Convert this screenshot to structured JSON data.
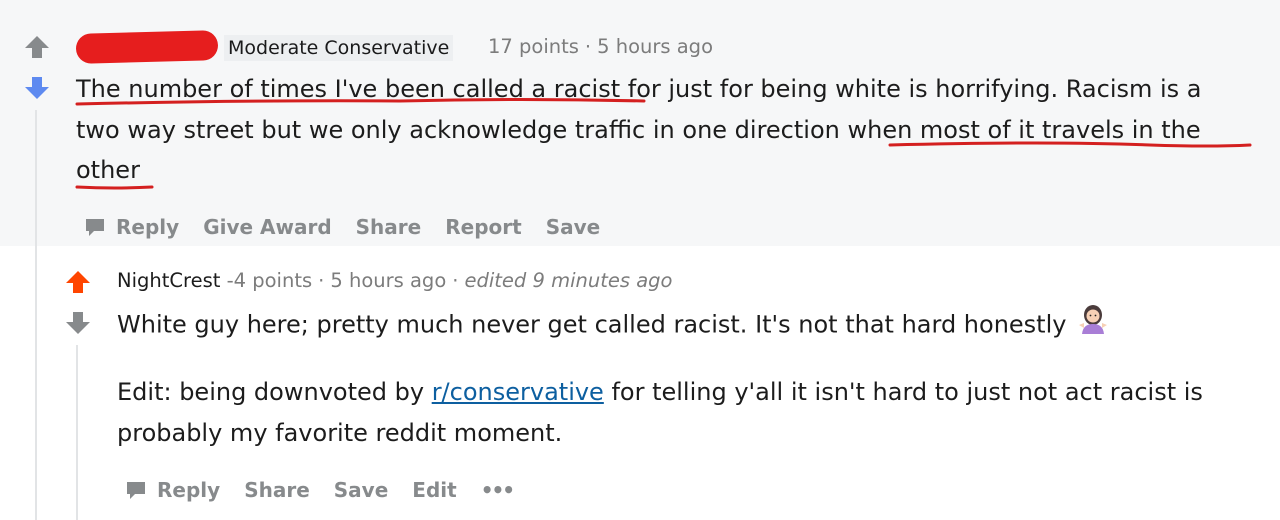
{
  "comment": {
    "flair": "Moderate Conservative",
    "points": "17 points",
    "time": "5 hours ago",
    "body": {
      "line1_underlined": "The number of times I've been called a racist",
      "line1_rest": " for just for being white is horrifying. Racism is a",
      "line2_plain": "two way street but we only acknowledge traffic in one direction ",
      "line2_underlined": "when most of it travels in the",
      "line3_underlined": "other"
    },
    "actions": [
      "Reply",
      "Give Award",
      "Share",
      "Report",
      "Save"
    ]
  },
  "reply": {
    "author": "NightCrest",
    "points": "-4 points",
    "time": "5 hours ago",
    "edited": "edited 9 minutes ago",
    "paragraph1": "White guy here; pretty much never get called racist. It's not that hard honestly",
    "emoji": "person-shrugging-emoji",
    "paragraph2_before": "Edit: being downvoted by ",
    "paragraph2_link": "r/conservative",
    "paragraph2_after_line1": " for telling y'all it isn't hard to just not act racist is",
    "paragraph2_line2": "probably my favorite reddit moment.",
    "actions": [
      "Reply",
      "Share",
      "Save",
      "Edit"
    ],
    "more_label": "•••"
  },
  "colors": {
    "upvote_active": "#ff4500",
    "downvote_active": "#5e8af0",
    "vote_inactive": "#878a8c",
    "redaction": "#e61e1e",
    "underline": "#d42020",
    "link": "#0d5fa0"
  }
}
